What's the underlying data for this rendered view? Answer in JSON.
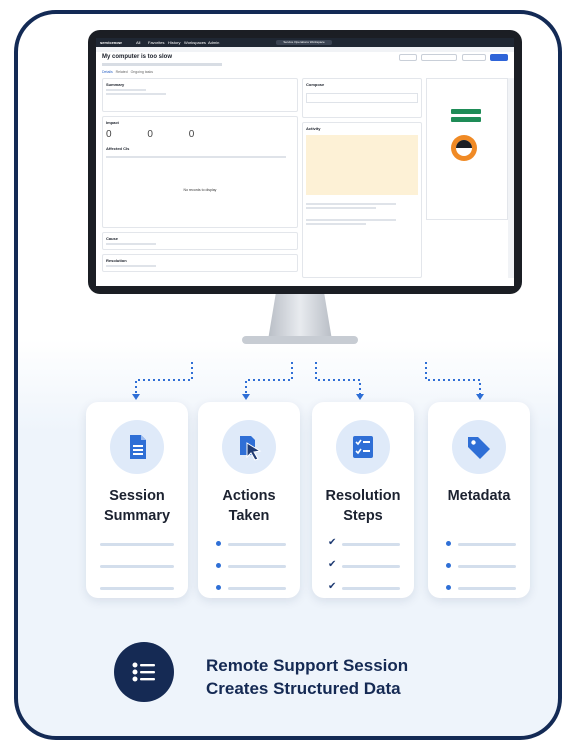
{
  "app": {
    "brand": "servicenow",
    "nav": [
      "All",
      "Favorites",
      "History",
      "Workspaces",
      "Admin"
    ],
    "workspace_pill": "Service Operations Workspace",
    "record_title": "My computer is too slow",
    "record_tabs": [
      "Details",
      "Related",
      "Ongoing tasks"
    ],
    "summary_title": "Summary",
    "impact_title": "Impact",
    "impact_values": [
      "0",
      "0",
      "0"
    ],
    "affected_title": "Affected CIs",
    "empty_text": "No records to display",
    "cause_title": "Cause",
    "resolution_title": "Resolution",
    "compose_title": "Compose",
    "activity_title": "Activity",
    "header_buttons": [
      "Save",
      "Create change request",
      "Assign to me",
      "Resolve"
    ],
    "right_buttons": [
      "Request access",
      "End chat"
    ]
  },
  "features": [
    {
      "title_line1": "Session",
      "title_line2": "Summary",
      "icon": "document-icon",
      "bullet": "none"
    },
    {
      "title_line1": "Actions",
      "title_line2": "Taken",
      "icon": "cursor-click-icon",
      "bullet": "dot"
    },
    {
      "title_line1": "Resolution",
      "title_line2": "Steps",
      "icon": "checklist-icon",
      "bullet": "check"
    },
    {
      "title_line1": "Metadata",
      "title_line2": "",
      "icon": "tag-icon",
      "bullet": "dot"
    }
  ],
  "headline": {
    "line1": "Remote Support Session",
    "line2": "Creates Structured Data",
    "icon": "list-icon"
  },
  "colors": {
    "navy": "#152a54",
    "accent": "#2f6fd6",
    "icon_bg": "#dfeaf9",
    "avatar_orange": "#f08a25"
  }
}
